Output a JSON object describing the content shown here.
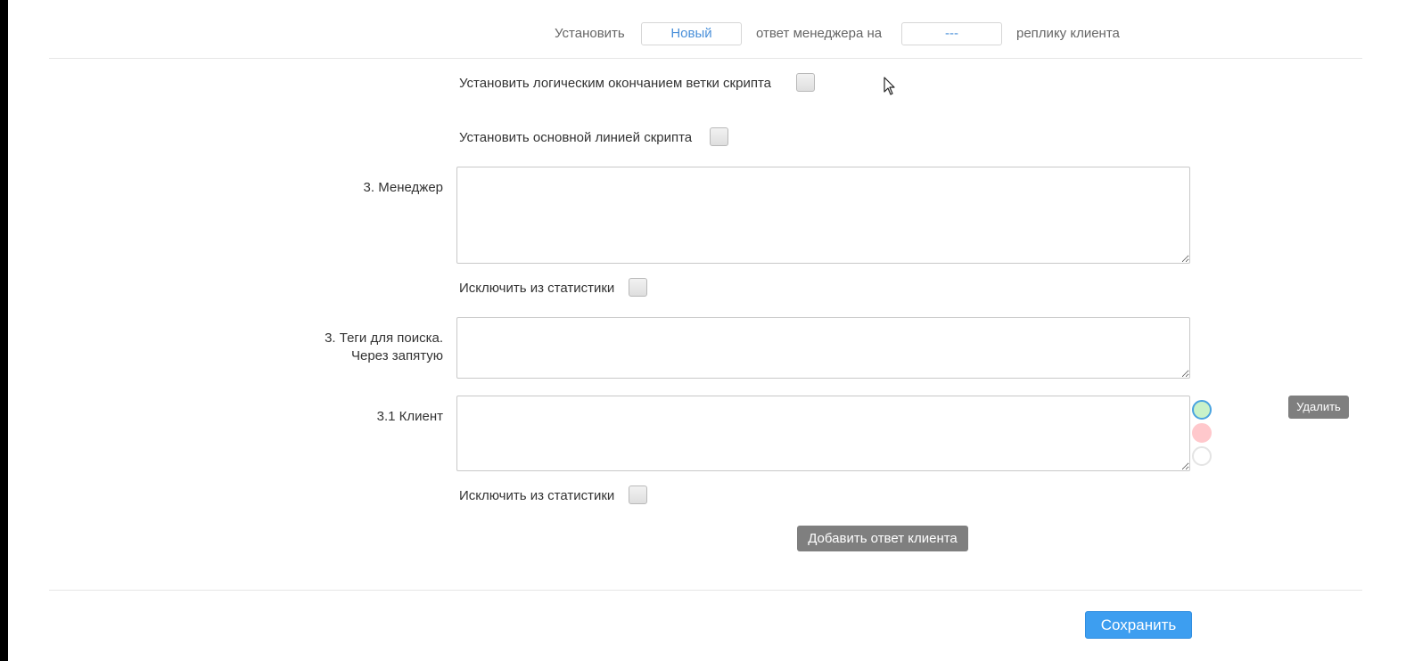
{
  "header": {
    "set_label": "Установить",
    "status_value": "Новый",
    "middle_label": "ответ менеджера на",
    "reply_value": "---",
    "end_label": "реплику клиента"
  },
  "options": {
    "logical_end_label": "Установить логическим окончанием ветки скрипта",
    "main_line_label": "Установить основной линией скрипта"
  },
  "manager": {
    "label": "3. Менеджер",
    "value": "",
    "exclude_label": "Исключить из статистики"
  },
  "tags": {
    "label_line1": "3. Теги для поиска.",
    "label_line2": "Через запятую",
    "value": ""
  },
  "client": {
    "label": "3.1 Клиент",
    "value": "",
    "delete_label": "Удалить",
    "exclude_label": "Исключить из статистики",
    "status_colors": [
      "#c9f2c9",
      "#ffc8cc",
      "#ffffff"
    ]
  },
  "actions": {
    "add_client_answer_label": "Добавить ответ клиента",
    "save_label": "Сохранить"
  }
}
